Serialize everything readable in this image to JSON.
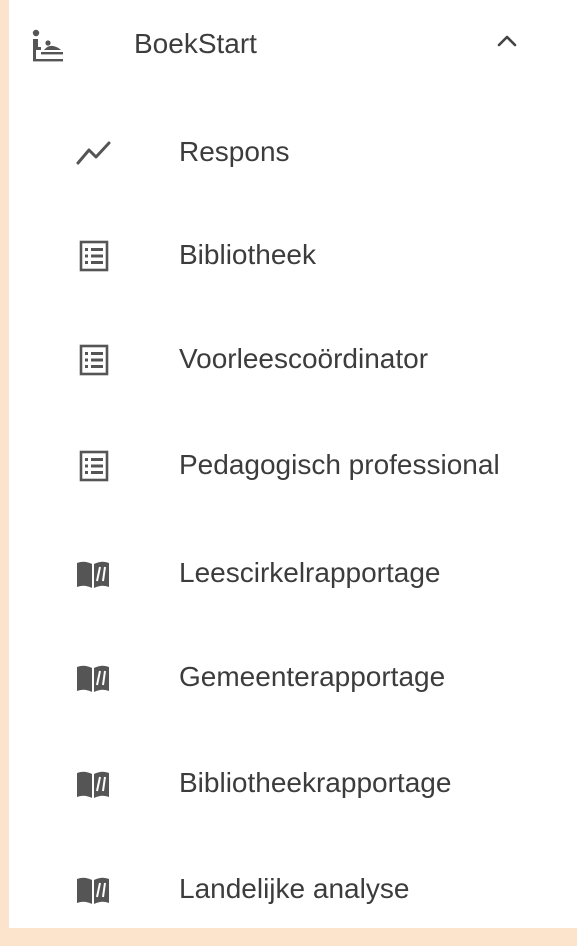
{
  "menu": {
    "header": {
      "icon": "baby-changing-icon",
      "label": "BoekStart",
      "expanded_icon": "chevron-up-icon"
    },
    "items": [
      {
        "label": "Respons",
        "icon": "trend-line-icon"
      },
      {
        "label": "Bibliotheek",
        "icon": "list-icon"
      },
      {
        "label": "Voorleescoördinator",
        "icon": "list-icon"
      },
      {
        "label": "Pedagogisch professional",
        "icon": "list-icon"
      },
      {
        "label": "Leescirkelrapportage",
        "icon": "open-book-icon"
      },
      {
        "label": "Gemeenterapportage",
        "icon": "open-book-icon"
      },
      {
        "label": "Bibliotheekrapportage",
        "icon": "open-book-icon"
      },
      {
        "label": "Landelijke analyse",
        "icon": "open-book-icon"
      }
    ]
  },
  "colors": {
    "background": "#fbe3cc",
    "panel": "#ffffff",
    "text": "#3c3c3c",
    "icon": "#555555"
  }
}
